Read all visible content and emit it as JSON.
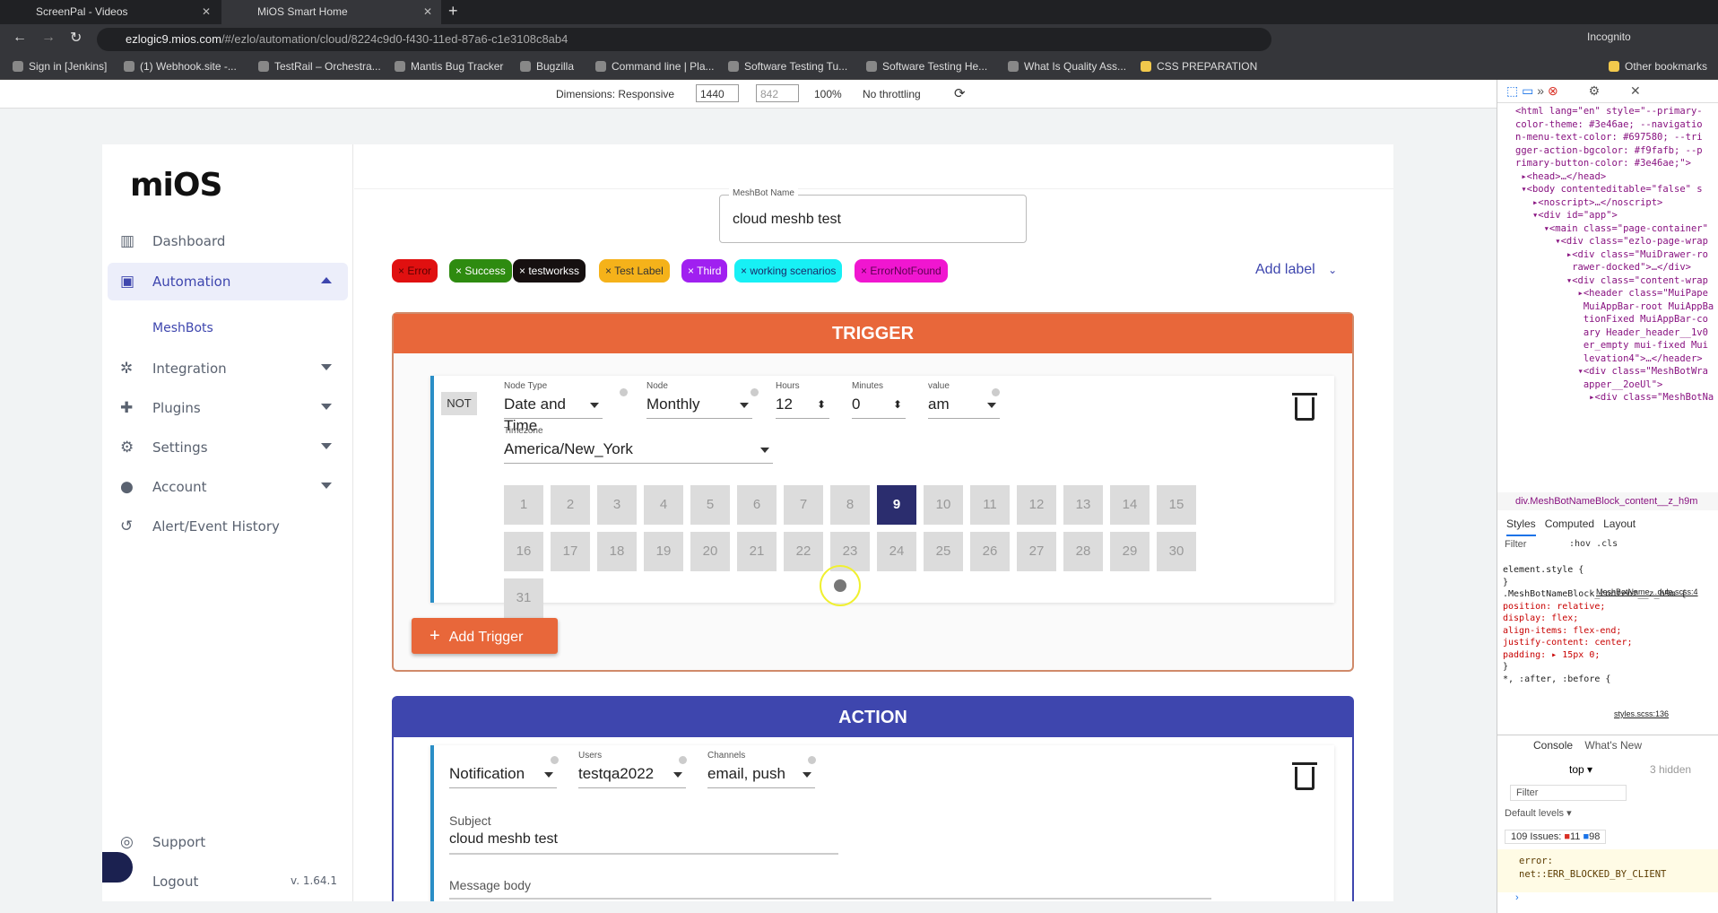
{
  "browser": {
    "tabs": [
      {
        "title": "ScreenPal - Videos"
      },
      {
        "title": "MiOS Smart Home"
      }
    ],
    "url_host": "ezlogic9.mios.com",
    "url_path": "/#/ezlo/automation/cloud/8224c9d0-f430-11ed-87a6-c1e3108c8ab4",
    "profile": "Incognito",
    "bookmarks": [
      "Sign in [Jenkins]",
      "(1) Webhook.site -...",
      "TestRail – Orchestra...",
      "Mantis Bug Tracker",
      "Bugzilla",
      "Command line | Pla...",
      "Software Testing Tu...",
      "Software Testing He...",
      "What Is Quality Ass...",
      "CSS PREPARATION"
    ],
    "other_bookmarks": "Other bookmarks"
  },
  "device_toolbar": {
    "dimensions": "Dimensions: Responsive",
    "width": "1440",
    "height": "842",
    "zoom": "100%",
    "throttling": "No throttling"
  },
  "sidebar": {
    "logo": "miOS",
    "items": [
      {
        "label": "Dashboard",
        "icon": "dashboard-icon"
      },
      {
        "label": "Automation",
        "icon": "automation-icon"
      },
      {
        "label": "MeshBots"
      },
      {
        "label": "Integration",
        "icon": "integration-icon"
      },
      {
        "label": "Plugins",
        "icon": "puzzle-icon"
      },
      {
        "label": "Settings",
        "icon": "gear-icon"
      },
      {
        "label": "Account",
        "icon": "account-icon"
      },
      {
        "label": "Alert/Event History",
        "icon": "history-icon"
      }
    ],
    "support": "Support",
    "logout": "Logout",
    "version": "v. 1.64.1"
  },
  "meshbot": {
    "name_label": "MeshBot Name",
    "name": "cloud meshb test",
    "labels": [
      {
        "text": "Error",
        "bg": "#e01010",
        "fg": "#5a0000"
      },
      {
        "text": "Success",
        "bg": "#2e8b10",
        "fg": "#ffffff"
      },
      {
        "text": "testworkss",
        "bg": "#161010",
        "fg": "#ffffff"
      },
      {
        "text": "Test Label",
        "bg": "#f5b21a",
        "fg": "#333333"
      },
      {
        "text": "Third",
        "bg": "#a020f0",
        "fg": "#ffffff"
      },
      {
        "text": "working scenarios",
        "bg": "#17f0f5",
        "fg": "#1a2a6a"
      },
      {
        "text": "ErrorNotFound",
        "bg": "#f016d0",
        "fg": "#5a0050"
      }
    ],
    "add_label": "Add label"
  },
  "trigger": {
    "title": "TRIGGER",
    "color": "#e8673a",
    "not": "NOT",
    "node_type_label": "Node Type",
    "node_type": "Date and Time",
    "node_label": "Node",
    "node": "Monthly",
    "hours_label": "Hours",
    "hours": "12",
    "minutes_label": "Minutes",
    "minutes": "0",
    "value_label": "value",
    "value": "am",
    "timezone_label": "Timezone",
    "timezone": "America/New_York",
    "selected_day": 9,
    "add_button": "Add Trigger"
  },
  "action": {
    "title": "ACTION",
    "color": "#3e46ae",
    "type": "Notification",
    "users_label": "Users",
    "users": "testqa2022",
    "channels_label": "Channels",
    "channels": "email, push",
    "subject_label": "Subject",
    "subject": "cloud meshb test",
    "body_label": "Message body"
  },
  "devtools": {
    "breadcrumb": "div.MeshBotNameBlock_content__z_h9m",
    "tabs": [
      "Styles",
      "Computed",
      "Layout"
    ],
    "filter": "Filter",
    "hov": ":hov",
    "cls": ".cls",
    "style_rule": ".MeshBotNameBlock_content__z_h9m {",
    "style_source": "MeshBotName…dule.scss:4",
    "props": [
      "position: relative;",
      "display: flex;",
      "align-items: flex-end;",
      "justify-content: center;",
      "padding: ▸ 15px 0;"
    ],
    "rule2": "*, :after, :before {",
    "rule2_source": "styles.scss:136",
    "console_tabs": [
      "Console",
      "What's New"
    ],
    "context": "top",
    "hidden": "3 hidden",
    "console_filter": "Filter",
    "levels": "Default levels",
    "issues": "109 Issues:",
    "errors": "11",
    "infos": "98",
    "log": "error:\nnet::ERR_BLOCKED_BY_CLIENT"
  }
}
